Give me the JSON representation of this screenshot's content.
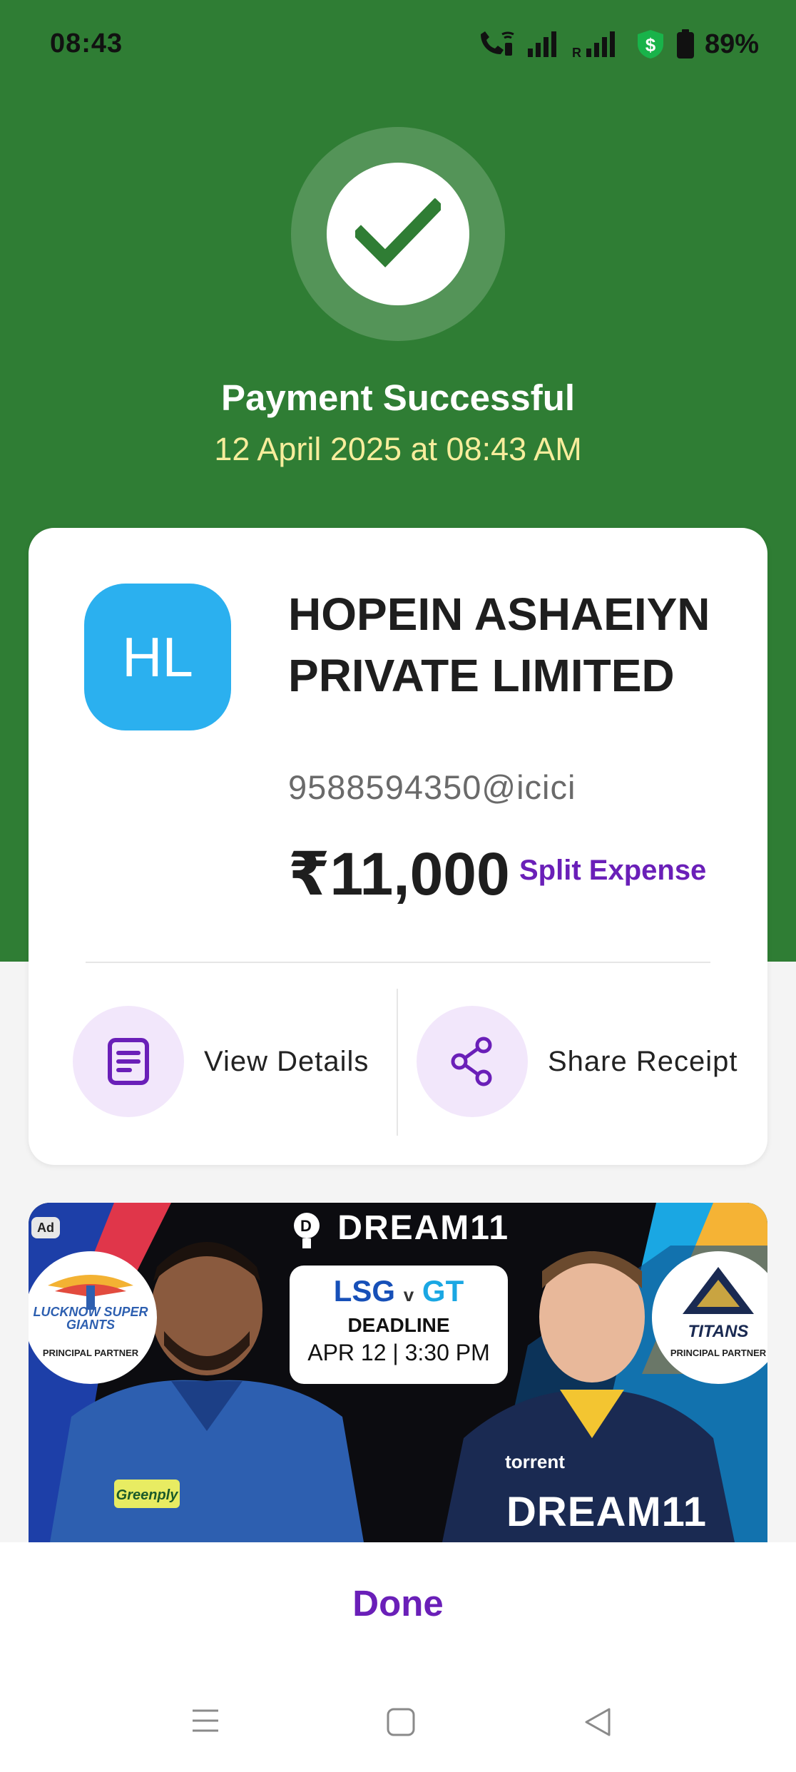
{
  "status_bar": {
    "time": "08:43",
    "battery": "89%"
  },
  "header": {
    "title": "Payment Successful",
    "datetime": "12 April 2025 at 08:43 AM"
  },
  "payee": {
    "initials": "HL",
    "name": "HOPEIN ASHAEIYN PRIVATE LIMITED",
    "upi_id": "9588594350@icici",
    "amount": "₹11,000",
    "split_label": "Split Expense"
  },
  "actions": {
    "view_details": "View Details",
    "share_receipt": "Share Receipt"
  },
  "ad": {
    "badge": "Ad",
    "brand": "DREAM11",
    "team_left": "LSG",
    "vs": "v",
    "team_right": "GT",
    "deadline_label": "DEADLINE",
    "deadline_time": "APR 12 | 3:30 PM",
    "left_team_name": "LUCKNOW SUPER GIANTS",
    "right_team_name": "TITANS",
    "partner_label": "PRINCIPAL PARTNER",
    "jersey_text": "DREAM11"
  },
  "footer": {
    "done_label": "Done"
  },
  "colors": {
    "header_green": "#2f7d34",
    "accent_purple": "#6a1fb8",
    "avatar_blue": "#2bb0ef",
    "date_yellow": "#f7ed9c"
  }
}
